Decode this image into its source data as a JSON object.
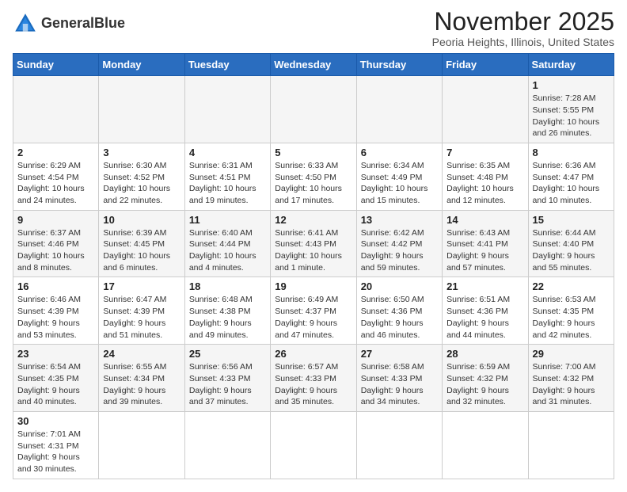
{
  "logo": {
    "text_regular": "General",
    "text_bold": "Blue"
  },
  "calendar": {
    "title": "November 2025",
    "subtitle": "Peoria Heights, Illinois, United States",
    "day_headers": [
      "Sunday",
      "Monday",
      "Tuesday",
      "Wednesday",
      "Thursday",
      "Friday",
      "Saturday"
    ],
    "weeks": [
      [
        {
          "day": "",
          "info": ""
        },
        {
          "day": "",
          "info": ""
        },
        {
          "day": "",
          "info": ""
        },
        {
          "day": "",
          "info": ""
        },
        {
          "day": "",
          "info": ""
        },
        {
          "day": "",
          "info": ""
        },
        {
          "day": "1",
          "info": "Sunrise: 7:28 AM\nSunset: 5:55 PM\nDaylight: 10 hours and 26 minutes."
        }
      ],
      [
        {
          "day": "2",
          "info": "Sunrise: 6:29 AM\nSunset: 4:54 PM\nDaylight: 10 hours and 24 minutes."
        },
        {
          "day": "3",
          "info": "Sunrise: 6:30 AM\nSunset: 4:52 PM\nDaylight: 10 hours and 22 minutes."
        },
        {
          "day": "4",
          "info": "Sunrise: 6:31 AM\nSunset: 4:51 PM\nDaylight: 10 hours and 19 minutes."
        },
        {
          "day": "5",
          "info": "Sunrise: 6:33 AM\nSunset: 4:50 PM\nDaylight: 10 hours and 17 minutes."
        },
        {
          "day": "6",
          "info": "Sunrise: 6:34 AM\nSunset: 4:49 PM\nDaylight: 10 hours and 15 minutes."
        },
        {
          "day": "7",
          "info": "Sunrise: 6:35 AM\nSunset: 4:48 PM\nDaylight: 10 hours and 12 minutes."
        },
        {
          "day": "8",
          "info": "Sunrise: 6:36 AM\nSunset: 4:47 PM\nDaylight: 10 hours and 10 minutes."
        }
      ],
      [
        {
          "day": "9",
          "info": "Sunrise: 6:37 AM\nSunset: 4:46 PM\nDaylight: 10 hours and 8 minutes."
        },
        {
          "day": "10",
          "info": "Sunrise: 6:39 AM\nSunset: 4:45 PM\nDaylight: 10 hours and 6 minutes."
        },
        {
          "day": "11",
          "info": "Sunrise: 6:40 AM\nSunset: 4:44 PM\nDaylight: 10 hours and 4 minutes."
        },
        {
          "day": "12",
          "info": "Sunrise: 6:41 AM\nSunset: 4:43 PM\nDaylight: 10 hours and 1 minute."
        },
        {
          "day": "13",
          "info": "Sunrise: 6:42 AM\nSunset: 4:42 PM\nDaylight: 9 hours and 59 minutes."
        },
        {
          "day": "14",
          "info": "Sunrise: 6:43 AM\nSunset: 4:41 PM\nDaylight: 9 hours and 57 minutes."
        },
        {
          "day": "15",
          "info": "Sunrise: 6:44 AM\nSunset: 4:40 PM\nDaylight: 9 hours and 55 minutes."
        }
      ],
      [
        {
          "day": "16",
          "info": "Sunrise: 6:46 AM\nSunset: 4:39 PM\nDaylight: 9 hours and 53 minutes."
        },
        {
          "day": "17",
          "info": "Sunrise: 6:47 AM\nSunset: 4:39 PM\nDaylight: 9 hours and 51 minutes."
        },
        {
          "day": "18",
          "info": "Sunrise: 6:48 AM\nSunset: 4:38 PM\nDaylight: 9 hours and 49 minutes."
        },
        {
          "day": "19",
          "info": "Sunrise: 6:49 AM\nSunset: 4:37 PM\nDaylight: 9 hours and 47 minutes."
        },
        {
          "day": "20",
          "info": "Sunrise: 6:50 AM\nSunset: 4:36 PM\nDaylight: 9 hours and 46 minutes."
        },
        {
          "day": "21",
          "info": "Sunrise: 6:51 AM\nSunset: 4:36 PM\nDaylight: 9 hours and 44 minutes."
        },
        {
          "day": "22",
          "info": "Sunrise: 6:53 AM\nSunset: 4:35 PM\nDaylight: 9 hours and 42 minutes."
        }
      ],
      [
        {
          "day": "23",
          "info": "Sunrise: 6:54 AM\nSunset: 4:35 PM\nDaylight: 9 hours and 40 minutes."
        },
        {
          "day": "24",
          "info": "Sunrise: 6:55 AM\nSunset: 4:34 PM\nDaylight: 9 hours and 39 minutes."
        },
        {
          "day": "25",
          "info": "Sunrise: 6:56 AM\nSunset: 4:33 PM\nDaylight: 9 hours and 37 minutes."
        },
        {
          "day": "26",
          "info": "Sunrise: 6:57 AM\nSunset: 4:33 PM\nDaylight: 9 hours and 35 minutes."
        },
        {
          "day": "27",
          "info": "Sunrise: 6:58 AM\nSunset: 4:33 PM\nDaylight: 9 hours and 34 minutes."
        },
        {
          "day": "28",
          "info": "Sunrise: 6:59 AM\nSunset: 4:32 PM\nDaylight: 9 hours and 32 minutes."
        },
        {
          "day": "29",
          "info": "Sunrise: 7:00 AM\nSunset: 4:32 PM\nDaylight: 9 hours and 31 minutes."
        }
      ],
      [
        {
          "day": "30",
          "info": "Sunrise: 7:01 AM\nSunset: 4:31 PM\nDaylight: 9 hours and 30 minutes."
        },
        {
          "day": "",
          "info": ""
        },
        {
          "day": "",
          "info": ""
        },
        {
          "day": "",
          "info": ""
        },
        {
          "day": "",
          "info": ""
        },
        {
          "day": "",
          "info": ""
        },
        {
          "day": "",
          "info": ""
        }
      ]
    ]
  }
}
